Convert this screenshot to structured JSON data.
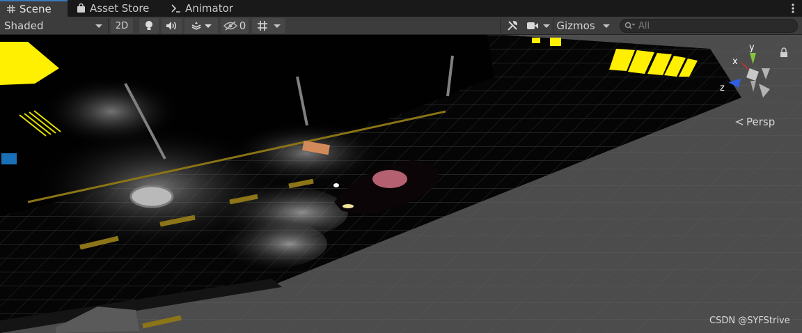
{
  "tabs": [
    {
      "label": "Scene",
      "icon": "grid-icon",
      "active": true
    },
    {
      "label": "Asset Store",
      "icon": "bag-icon",
      "active": false
    },
    {
      "label": "Animator",
      "icon": "animator-icon",
      "active": false
    }
  ],
  "toolbar": {
    "shading_mode": "Shaded",
    "mode_2d": "2D",
    "hidden_count": "0",
    "gizmos_label": "Gizmos",
    "search_placeholder": "All"
  },
  "scene": {
    "gizmo_axes": {
      "x": "x",
      "y": "y",
      "z": "z"
    },
    "projection_label": "Persp"
  },
  "watermark": "CSDN @SYFStrive",
  "colors": {
    "tab_accent": "#3a79bb",
    "axis_x": "#d8312c",
    "axis_y": "#86c23c",
    "axis_z": "#2f5fe0",
    "neon_yellow": "#ffef00"
  }
}
